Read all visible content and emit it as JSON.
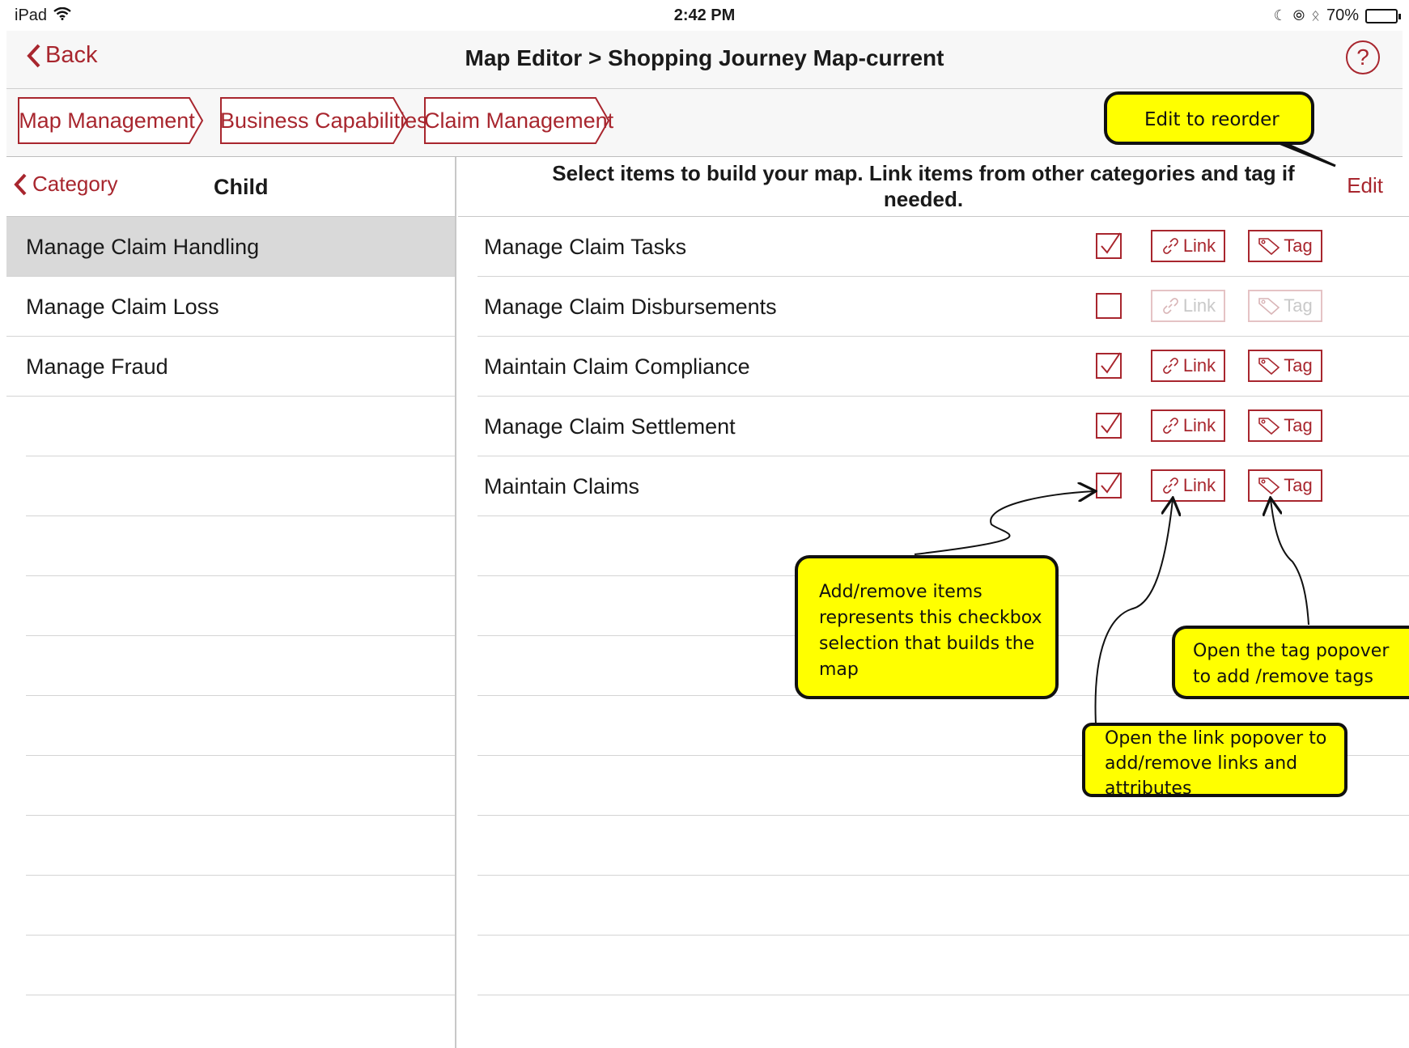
{
  "status_bar": {
    "device": "iPad",
    "time": "2:42 PM",
    "battery": "70%",
    "battery_level": 0.7
  },
  "nav": {
    "back_label": "Back",
    "title": "Map Editor > Shopping Journey Map-current",
    "help_symbol": "?"
  },
  "breadcrumbs": [
    "Map Management",
    "Business Capabilities",
    "Claim Management"
  ],
  "left_panel": {
    "back_label": "Category",
    "title": "Child",
    "items": [
      "Manage Claim Handling",
      "Manage Claim Loss",
      "Manage Fraud"
    ],
    "selected_index": 0
  },
  "right_panel": {
    "instructions": "Select items to build your map. Link items from other categories and tag if needed.",
    "edit_label": "Edit",
    "link_label": "Link",
    "tag_label": "Tag",
    "items": [
      {
        "name": "Manage Claim Tasks",
        "checked": true
      },
      {
        "name": "Manage Claim Disbursements",
        "checked": false
      },
      {
        "name": "Maintain Claim Compliance",
        "checked": true
      },
      {
        "name": "Manage Claim Settlement",
        "checked": true
      },
      {
        "name": "Maintain Claims",
        "checked": true
      }
    ]
  },
  "callouts": {
    "reorder": "Edit to reorder",
    "checkbox": "Add/remove items represents this checkbox selection that builds the map",
    "tag": "Open the tag popover to add /remove tags",
    "link": "Open the link popover to add/remove  links and attributes"
  },
  "colors": {
    "accent": "#a8262e",
    "callout": "#ffff00",
    "selected_row": "#d9d9d9"
  }
}
